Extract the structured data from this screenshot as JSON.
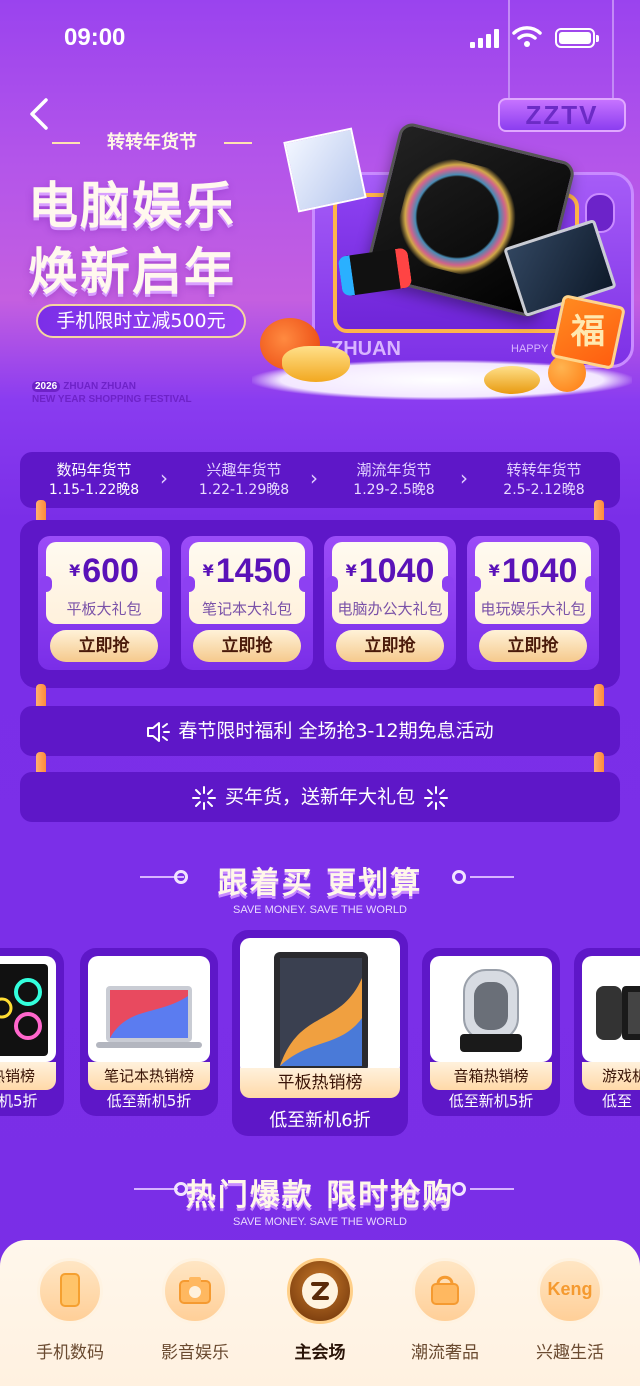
{
  "status_bar": {
    "time": "09:00"
  },
  "hero": {
    "brand_tag": "ZZTV",
    "festival_tag": "转转年货节",
    "title_line1": "电脑娱乐",
    "title_line2": "焕新启年",
    "promo": "手机限时立减500元",
    "festival_year": "2026",
    "festival_en_line1": "ZHUAN ZHUAN",
    "festival_en_line2": "NEW YEAR SHOPPING FESTIVAL",
    "tv_label": "ZHUAN",
    "tv_greeting": "HAPPY N",
    "fu_char": "福"
  },
  "schedule": [
    {
      "name": "数码年货节",
      "dates": "1.15-1.22晚8",
      "active": true
    },
    {
      "name": "兴趣年货节",
      "dates": "1.22-1.29晚8",
      "active": false
    },
    {
      "name": "潮流年货节",
      "dates": "1.29-2.5晚8",
      "active": false
    },
    {
      "name": "转转年货节",
      "dates": "2.5-2.12晚8",
      "active": false
    }
  ],
  "coupons": [
    {
      "currency": "¥",
      "amount": "600",
      "name": "平板大礼包",
      "button": "立即抢"
    },
    {
      "currency": "¥",
      "amount": "1450",
      "name": "笔记本大礼包",
      "button": "立即抢"
    },
    {
      "currency": "¥",
      "amount": "1040",
      "name": "电脑办公大礼包",
      "button": "立即抢"
    },
    {
      "currency": "¥",
      "amount": "1040",
      "name": "电玩娱乐大礼包",
      "button": "立即抢"
    }
  ],
  "banners": {
    "interest_free": "春节限时福利 全场抢3-12期免息活动",
    "gift": "买年货，送新年大礼包"
  },
  "section_follow": {
    "title": "跟着买 更划算",
    "subtitle": "SAVE MONEY. SAVE THE WORLD"
  },
  "rankings": [
    {
      "label": "热销榜",
      "sub": "机5折",
      "icon": "pc-tower-icon"
    },
    {
      "label": "笔记本热销榜",
      "sub": "低至新机5折",
      "icon": "laptop-icon"
    },
    {
      "label": "平板热销榜",
      "sub": "低至新机6折",
      "icon": "tablet-icon"
    },
    {
      "label": "音箱热销榜",
      "sub": "低至新机5折",
      "icon": "speaker-icon"
    },
    {
      "label": "游戏机",
      "sub": "低至",
      "icon": "game-console-icon"
    }
  ],
  "section_hot": {
    "title": "热门爆款 限时抢购",
    "subtitle": "SAVE MONEY. SAVE THE WORLD"
  },
  "tabs": [
    {
      "label": "手机数码",
      "icon": "phone-icon"
    },
    {
      "label": "影音娱乐",
      "icon": "camera-icon"
    },
    {
      "label": "主会场",
      "icon": "main-venue-icon",
      "active": true
    },
    {
      "label": "潮流奢品",
      "icon": "handbag-icon"
    },
    {
      "label": "兴趣生活",
      "icon": "keng-icon",
      "icon_text": "Keng"
    }
  ],
  "colors": {
    "accent_purple": "#7a2ee6",
    "panel_purple": "#5e17c8",
    "gold": "#f5c98c"
  }
}
